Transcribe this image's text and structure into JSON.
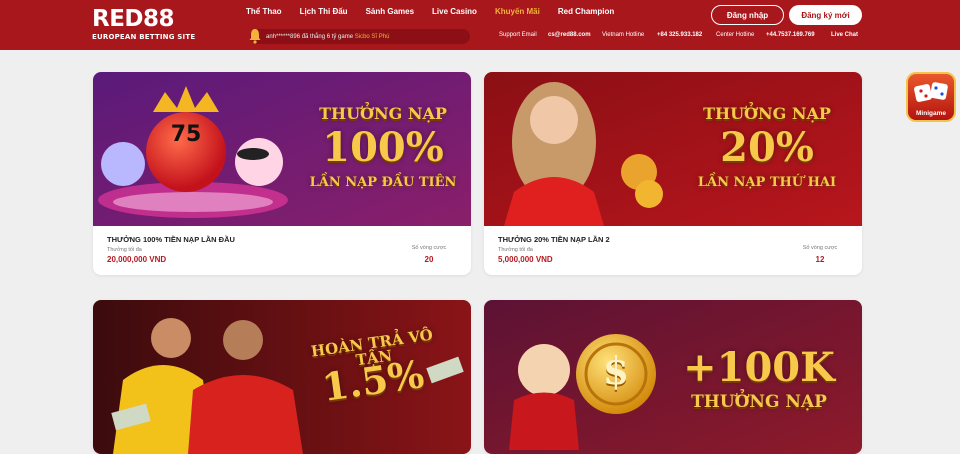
{
  "brand": {
    "name": "RED88",
    "tagline": "EUROPEAN BETTING SITE"
  },
  "nav": [
    {
      "label": "Thể Thao",
      "active": false
    },
    {
      "label": "Lịch Thi Đấu",
      "active": false
    },
    {
      "label": "Sảnh Games",
      "active": false
    },
    {
      "label": "Live Casino",
      "active": false
    },
    {
      "label": "Khuyến Mãi",
      "active": true
    },
    {
      "label": "Red Champion",
      "active": false
    }
  ],
  "ticker": {
    "prefix": "anh******896 đã thắng 6 tỷ game ",
    "highlight": "Sicbo Sĩ Phú"
  },
  "auth": {
    "login": "Đăng nhập",
    "register": "Đăng ký mới"
  },
  "contact": {
    "email_label": "Support Email",
    "email": "cs@red88.com",
    "vn_label": "Vietnam Hotline",
    "vn": "+84 325.933.182",
    "center_label": "Center Hotline",
    "center": "+44.7537.169.769",
    "chat": "Live Chat"
  },
  "cards": [
    {
      "banner_line1": "THƯỞNG NẠP",
      "banner_line2": "100%",
      "banner_line3": "LẦN NẠP ĐẦU TIÊN",
      "ball_number": "75",
      "title": "THƯỞNG 100% TIỀN NẠP LẦN ĐẦU",
      "sub": "Thưởng tối đa",
      "amount": "20,000,000 VND",
      "round_label": "Số vòng cược",
      "round_value": "20"
    },
    {
      "banner_line1": "THƯỞNG NẠP",
      "banner_line2": "20%",
      "banner_line3": "LẦN NẠP THỨ HAI",
      "title": "THƯỞNG 20% TIỀN NẠP LẦN 2",
      "sub": "Thưởng tối đa",
      "amount": "5,000,000 VND",
      "round_label": "Số vòng cược",
      "round_value": "12"
    },
    {
      "banner_line1": "HOÀN TRẢ VÔ TẬN",
      "banner_line2": "1.5%"
    },
    {
      "banner_line1": "+100K",
      "banner_line2": "THƯỞNG NẠP",
      "coin_symbol": "$"
    }
  ],
  "minigame": {
    "label": "Minigame"
  },
  "colors": {
    "header": "#a8171c",
    "accent": "#f3b23a",
    "gold": "#f7c84a",
    "amount": "#b31b20"
  },
  "icons": [
    "bell-icon",
    "bingo-ball-icon",
    "coin-icon",
    "dice-icon"
  ]
}
